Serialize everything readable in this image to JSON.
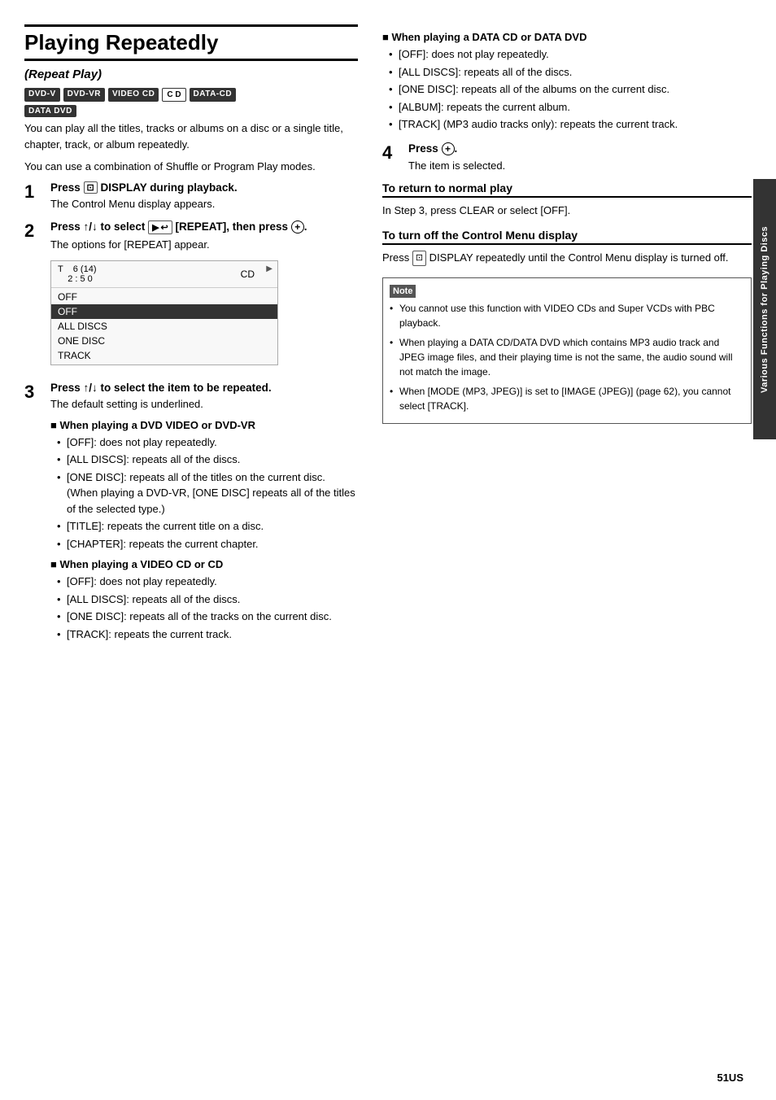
{
  "page": {
    "title": "Playing Repeatedly",
    "subtitle": "(Repeat Play)",
    "page_number": "51US"
  },
  "badges": [
    "DVD-V",
    "DVD-VR",
    "VIDEO CD",
    "C D",
    "DATA-CD",
    "DATA DVD"
  ],
  "intro": {
    "text1": "You can play all the titles, tracks or albums on a disc or a single title, chapter, track, or album repeatedly.",
    "text2": "You can use a combination of Shuffle or Program Play modes."
  },
  "steps": [
    {
      "number": "1",
      "title": "Press  DISPLAY during playback.",
      "desc": "The Control Menu display appears."
    },
    {
      "number": "2",
      "title": "Press ↑/↓ to select  [REPEAT], then press ⊕.",
      "desc": "The options for [REPEAT] appear."
    },
    {
      "number": "3",
      "title": "Press ↑/↓ to select the item to be repeated.",
      "desc": "The default setting is underlined."
    },
    {
      "number": "4",
      "title": "Press ⊕.",
      "desc": "The item is selected."
    }
  ],
  "display_box": {
    "top_left": "T",
    "track_time": "6 (14)\n2 : 5 0",
    "top_right": "CD",
    "menu_items": [
      "OFF",
      "OFF",
      "ALL DISCS",
      "ONE DISC",
      "TRACK"
    ],
    "selected_index": 1
  },
  "dvd_section": {
    "heading": "■ When playing a DVD VIDEO or DVD-VR",
    "items": [
      "[OFF]: does not play repeatedly.",
      "[ALL DISCS]: repeats all of the discs.",
      "[ONE DISC]: repeats all of the titles on the current disc. (When playing a DVD-VR, [ONE DISC] repeats all of the titles of the selected type.)",
      "[TITLE]: repeats the current title on a disc.",
      "[CHAPTER]: repeats the current chapter."
    ]
  },
  "video_cd_section": {
    "heading": "■ When playing a VIDEO CD or CD",
    "items": [
      "[OFF]: does not play repeatedly.",
      "[ALL DISCS]: repeats all of the discs.",
      "[ONE DISC]: repeats all of the tracks on the current disc.",
      "[TRACK]: repeats the current track."
    ]
  },
  "data_cd_section": {
    "heading": "■ When playing a DATA CD or DATA DVD",
    "items": [
      "[OFF]: does not play repeatedly.",
      "[ALL DISCS]: repeats all of the discs.",
      "[ONE DISC]: repeats all of the albums on the current disc.",
      "[ALBUM]: repeats the current album.",
      "[TRACK] (MP3 audio tracks only): repeats the current track."
    ]
  },
  "return_to_normal": {
    "title": "To return to normal play",
    "desc": "In Step 3, press CLEAR or select [OFF]."
  },
  "turn_off_menu": {
    "title": "To turn off the Control Menu display",
    "desc": "Press  DISPLAY repeatedly until the Control Menu display is turned off."
  },
  "note": {
    "label": "Note",
    "items": [
      "You cannot use this function with VIDEO CDs and Super VCDs with PBC playback.",
      "When playing a DATA CD/DATA DVD which contains MP3 audio track and JPEG image files, and their playing time is not the same, the audio sound will not match the image.",
      "When [MODE (MP3, JPEG)] is set to [IMAGE (JPEG)] (page 62), you cannot select [TRACK]."
    ]
  },
  "sidebar": {
    "text": "Various Functions for Playing Discs"
  }
}
